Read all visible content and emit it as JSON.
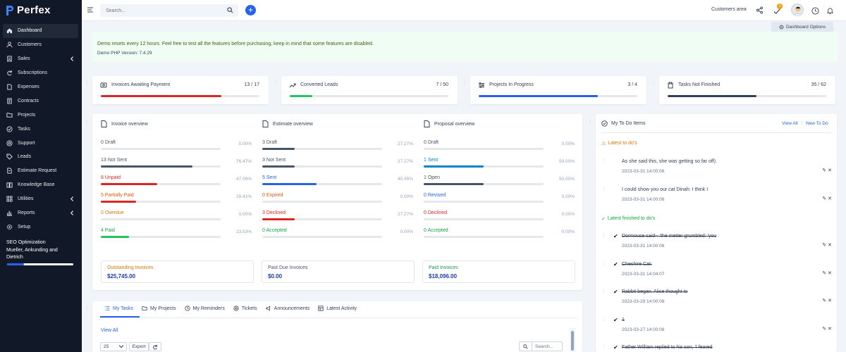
{
  "app": {
    "name": "Perfex"
  },
  "sidebar": {
    "items": [
      {
        "label": "Dashboard",
        "icon": "home-icon",
        "active": true
      },
      {
        "label": "Customers",
        "icon": "user-icon"
      },
      {
        "label": "Sales",
        "icon": "receipt-icon",
        "has_submenu": true
      },
      {
        "label": "Subscriptions",
        "icon": "refresh-icon"
      },
      {
        "label": "Expenses",
        "icon": "document-icon"
      },
      {
        "label": "Contracts",
        "icon": "contract-icon"
      },
      {
        "label": "Projects",
        "icon": "folder-icon"
      },
      {
        "label": "Tasks",
        "icon": "check-circle-icon"
      },
      {
        "label": "Support",
        "icon": "lifebuoy-icon"
      },
      {
        "label": "Leads",
        "icon": "tag-icon"
      },
      {
        "label": "Estimate Request",
        "icon": "file-icon"
      },
      {
        "label": "Knowledge Base",
        "icon": "book-icon"
      },
      {
        "label": "Utilities",
        "icon": "grid-icon",
        "has_submenu": true
      },
      {
        "label": "Reports",
        "icon": "chart-icon",
        "has_submenu": true
      },
      {
        "label": "Setup",
        "icon": "gear-icon"
      }
    ],
    "project": {
      "name_line1": "SEO Optimization",
      "name_line2": "Mueller, Ankunding and",
      "name_line3": "Dietrich",
      "progress": 0.25
    }
  },
  "topbar": {
    "search_placeholder": "Search...",
    "customers_area": "Customers area",
    "notifications_count": "2"
  },
  "dashboard_options": "Dashboard Options",
  "banner": {
    "message": "Demo resets every 12 hours. Feel free to test all the features before purchasing, keep in mind that some features are disabled.",
    "version": "Demo PHP Version: 7.4.29"
  },
  "stats": [
    {
      "label": "Invoices Awaiting Payment",
      "value": "13 / 17",
      "progress": 0.76,
      "color": "#dc2626",
      "icon": "invoice-icon"
    },
    {
      "label": "Converted Leads",
      "value": "7 / 50",
      "progress": 0.14,
      "color": "#22c55e",
      "icon": "trending-up-icon"
    },
    {
      "label": "Projects In Progress",
      "value": "3 / 4",
      "progress": 0.75,
      "color": "#2563eb",
      "icon": "sliders-icon"
    },
    {
      "label": "Tasks Not Finished",
      "value": "35 / 62",
      "progress": 0.56,
      "color": "#334155",
      "icon": "clipboard-icon"
    }
  ],
  "invoice_overview": {
    "title": "Invoice overview",
    "rows": [
      {
        "label": "0 Draft",
        "pct": "0.00%",
        "progress": 0.0,
        "color": "#64748b",
        "textcolor": "#475569"
      },
      {
        "label": "13 Not Sent",
        "pct": "76.47%",
        "progress": 0.7647,
        "color": "#475569",
        "textcolor": "#475569"
      },
      {
        "label": "8 Unpaid",
        "pct": "47.06%",
        "progress": 0.4706,
        "color": "#dc2626",
        "textcolor": "#dc2626"
      },
      {
        "label": "5 Partially Paid",
        "pct": "29.41%",
        "progress": 0.2941,
        "color": "#dc2626",
        "textcolor": "#ea580c"
      },
      {
        "label": "0 Overdue",
        "pct": "0.00%",
        "progress": 0.0,
        "color": "#f59e0b",
        "textcolor": "#d97706"
      },
      {
        "label": "4 Paid",
        "pct": "23.53%",
        "progress": 0.2353,
        "color": "#22c55e",
        "textcolor": "#16a34a"
      }
    ],
    "totals": [
      {
        "label": "Outstanding Invoices",
        "value": "$25,745.00",
        "labelcolor": "#d97706"
      },
      {
        "label": "Past Due Invoices",
        "value": "$0.00",
        "labelcolor": "#475569"
      },
      {
        "label": "Paid Invoices",
        "value": "$18,096.00",
        "labelcolor": "#16a34a"
      }
    ]
  },
  "estimate_overview": {
    "title": "Estimate overview",
    "rows": [
      {
        "label": "3 Draft",
        "pct": "27.27%",
        "progress": 0.2727,
        "color": "#475569",
        "textcolor": "#475569"
      },
      {
        "label": "3 Not Sent",
        "pct": "27.27%",
        "progress": 0.2727,
        "color": "#475569",
        "textcolor": "#475569"
      },
      {
        "label": "5 Sent",
        "pct": "45.45%",
        "progress": 0.4545,
        "color": "#2563eb",
        "textcolor": "#2563eb"
      },
      {
        "label": "0 Expired",
        "pct": "0.00%",
        "progress": 0.0,
        "color": "#f59e0b",
        "textcolor": "#ea580c"
      },
      {
        "label": "3 Declined",
        "pct": "27.27%",
        "progress": 0.2727,
        "color": "#dc2626",
        "textcolor": "#dc2626"
      },
      {
        "label": "0 Accepted",
        "pct": "0.00%",
        "progress": 0.0,
        "color": "#22c55e",
        "textcolor": "#16a34a"
      }
    ]
  },
  "proposal_overview": {
    "title": "Proposal overview",
    "rows": [
      {
        "label": "0 Draft",
        "pct": "0.00%",
        "progress": 0.0,
        "color": "#475569",
        "textcolor": "#475569"
      },
      {
        "label": "1 Sent",
        "pct": "50.00%",
        "progress": 0.5,
        "color": "#0284c7",
        "textcolor": "#0284c7"
      },
      {
        "label": "1 Open",
        "pct": "50.00%",
        "progress": 0.5,
        "color": "#475569",
        "textcolor": "#475569"
      },
      {
        "label": "0 Revised",
        "pct": "0.00%",
        "progress": 0.0,
        "color": "#2563eb",
        "textcolor": "#2563eb"
      },
      {
        "label": "0 Declined",
        "pct": "0.00%",
        "progress": 0.0,
        "color": "#dc2626",
        "textcolor": "#dc2626"
      },
      {
        "label": "0 Accepted",
        "pct": "0.00%",
        "progress": 0.0,
        "color": "#22c55e",
        "textcolor": "#16a34a"
      }
    ]
  },
  "tabs": {
    "items": [
      "My Tasks",
      "My Projects",
      "My Reminders",
      "Tickets",
      "Announcements",
      "Latest Activity"
    ],
    "view_all": "View All",
    "page_size": "25",
    "export": "Export",
    "search_placeholder": "Search..."
  },
  "todo": {
    "title": "My To Do Items",
    "view_all": "View All",
    "new_todo": "New To Do",
    "latest_heading": "Latest to do's",
    "finished_heading": "Latest finished to do's",
    "latest": [
      {
        "text": "As she said this, she was getting so far off).",
        "date": "2023-03-31 14:00:06"
      },
      {
        "text": "I could show you our cat Dinah: I think I",
        "date": "2023-03-31 14:00:06"
      }
    ],
    "finished": [
      {
        "text": "Dormouse said-- 'the metter grumbled: 'you",
        "date": "2023-03-31 14:00:06"
      },
      {
        "text": "Cheshire Cat:",
        "date": "2023-03-31 14:04:07"
      },
      {
        "text": "Rabbit began. Alice thought to",
        "date": "2023-03-29 14:00:08"
      },
      {
        "text": "1",
        "date": "2023-03-27 14:00:06"
      },
      {
        "text": "Father William replied to his son, 'I feared",
        "date": ""
      }
    ]
  }
}
